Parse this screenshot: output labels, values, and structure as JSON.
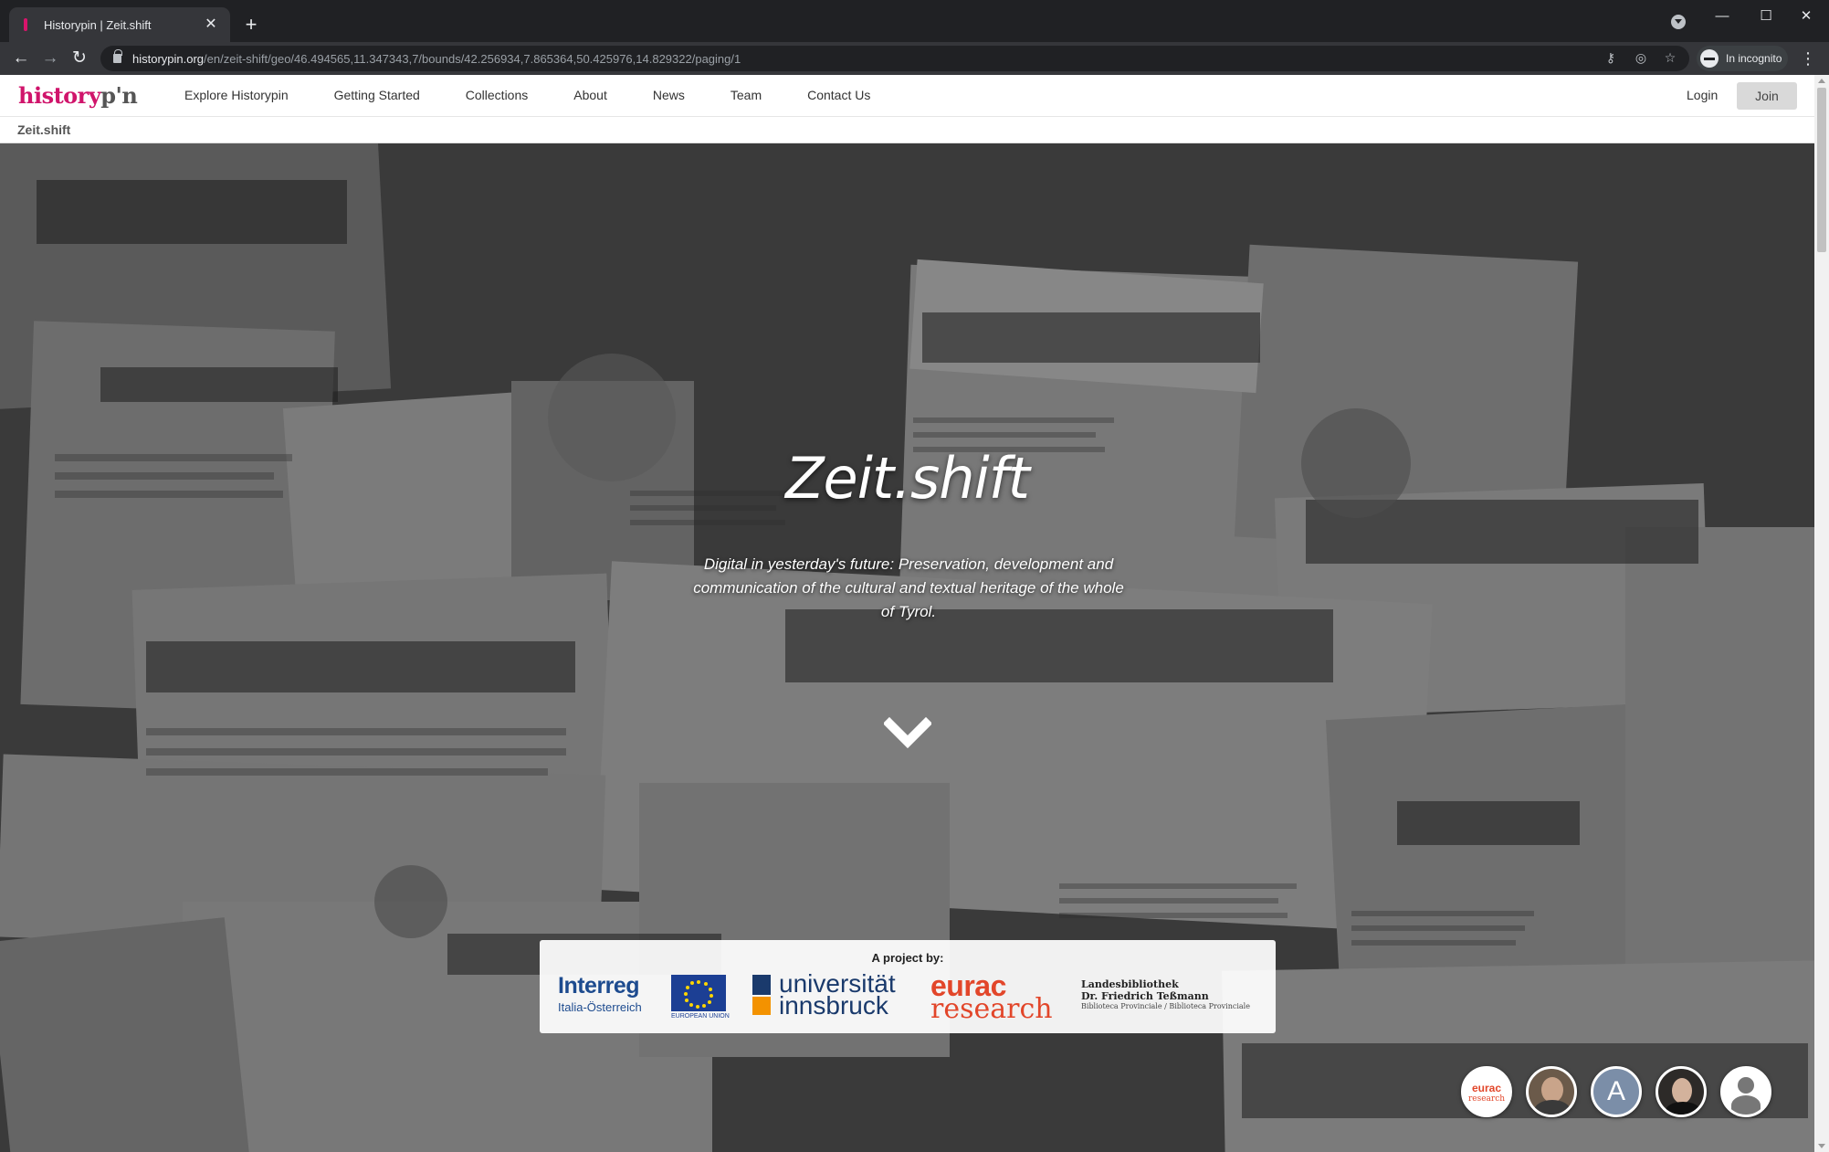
{
  "browser": {
    "tab_title": "Historypin | Zeit.shift",
    "url_host": "historypin.org",
    "url_path": "/en/zeit-shift/geo/46.494565,11.347343,7/bounds/42.256934,7.865364,50.425976,14.829322/paging/1",
    "incognito_label": "In incognito"
  },
  "site": {
    "logo_main": "history",
    "logo_pin": "p'n",
    "nav": [
      "Explore Historypin",
      "Getting Started",
      "Collections",
      "About",
      "News",
      "Team",
      "Contact Us"
    ],
    "login": "Login",
    "join": "Join",
    "breadcrumb": "Zeit.shift"
  },
  "hero": {
    "title": "Zeit.shift",
    "subtitle": "Digital in yesterday's future: Preservation, development and communication of the cultural and textual heritage of the whole of Tyrol.",
    "partners_label": "A project by:",
    "partners": {
      "interreg": "Interreg",
      "interreg_sub": "Italia-Österreich",
      "eu_caption": "EUROPEAN UNION",
      "uibk_line1": "universität",
      "uibk_line2": "innsbruck",
      "eurac_line1": "eurac",
      "eurac_line2": "research",
      "tess_line1": "Landesbibliothek",
      "tess_line2": "Dr. Friedrich Teßmann",
      "tess_line3": "Biblioteca Provinciale / Biblioteca Provinciale"
    },
    "avatars": {
      "eurac_a": "eurac",
      "eurac_b": "research",
      "letter": "A"
    }
  },
  "colors": {
    "brand": "#d0146b",
    "chrome_bg": "#202124",
    "chrome_tab": "#35363a",
    "eurac": "#e2462a",
    "uibk_blue": "#1a3a6c",
    "uibk_orange": "#f39200"
  }
}
